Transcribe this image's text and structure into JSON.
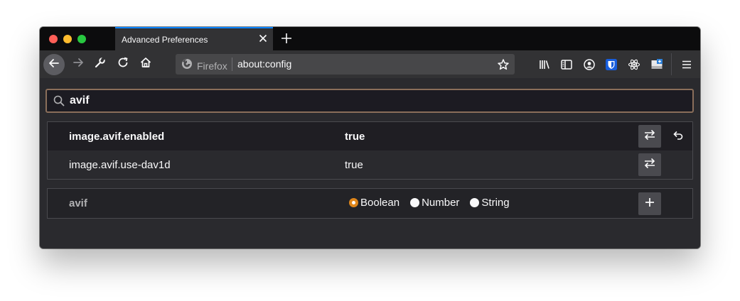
{
  "window": {
    "tab": {
      "title": "Advanced Preferences"
    }
  },
  "navbar": {
    "identity_label": "Firefox",
    "url": "about:config"
  },
  "search": {
    "value": "avif"
  },
  "prefs": [
    {
      "name": "image.avif.enabled",
      "value": "true",
      "modified": true
    },
    {
      "name": "image.avif.use-dav1d",
      "value": "true",
      "modified": false
    }
  ],
  "new_pref": {
    "name": "avif",
    "types": [
      {
        "label": "Boolean",
        "selected": true
      },
      {
        "label": "Number",
        "selected": false
      },
      {
        "label": "String",
        "selected": false
      }
    ]
  },
  "colors": {
    "accent_tab": "#0a84ff",
    "radio_selected": "#e0861a",
    "search_border": "#8a6e5a"
  },
  "icons": [
    "close-icon",
    "plus-icon",
    "back-arrow-icon",
    "forward-arrow-icon",
    "wrench-icon",
    "reload-icon",
    "home-icon",
    "firefox-logo-icon",
    "bookmark-star-icon",
    "library-icon",
    "sidebar-icon",
    "account-icon",
    "bitwarden-shield-icon",
    "react-devtools-icon",
    "extension-icon",
    "hamburger-menu-icon",
    "search-icon",
    "toggle-arrows-icon",
    "reset-icon"
  ]
}
